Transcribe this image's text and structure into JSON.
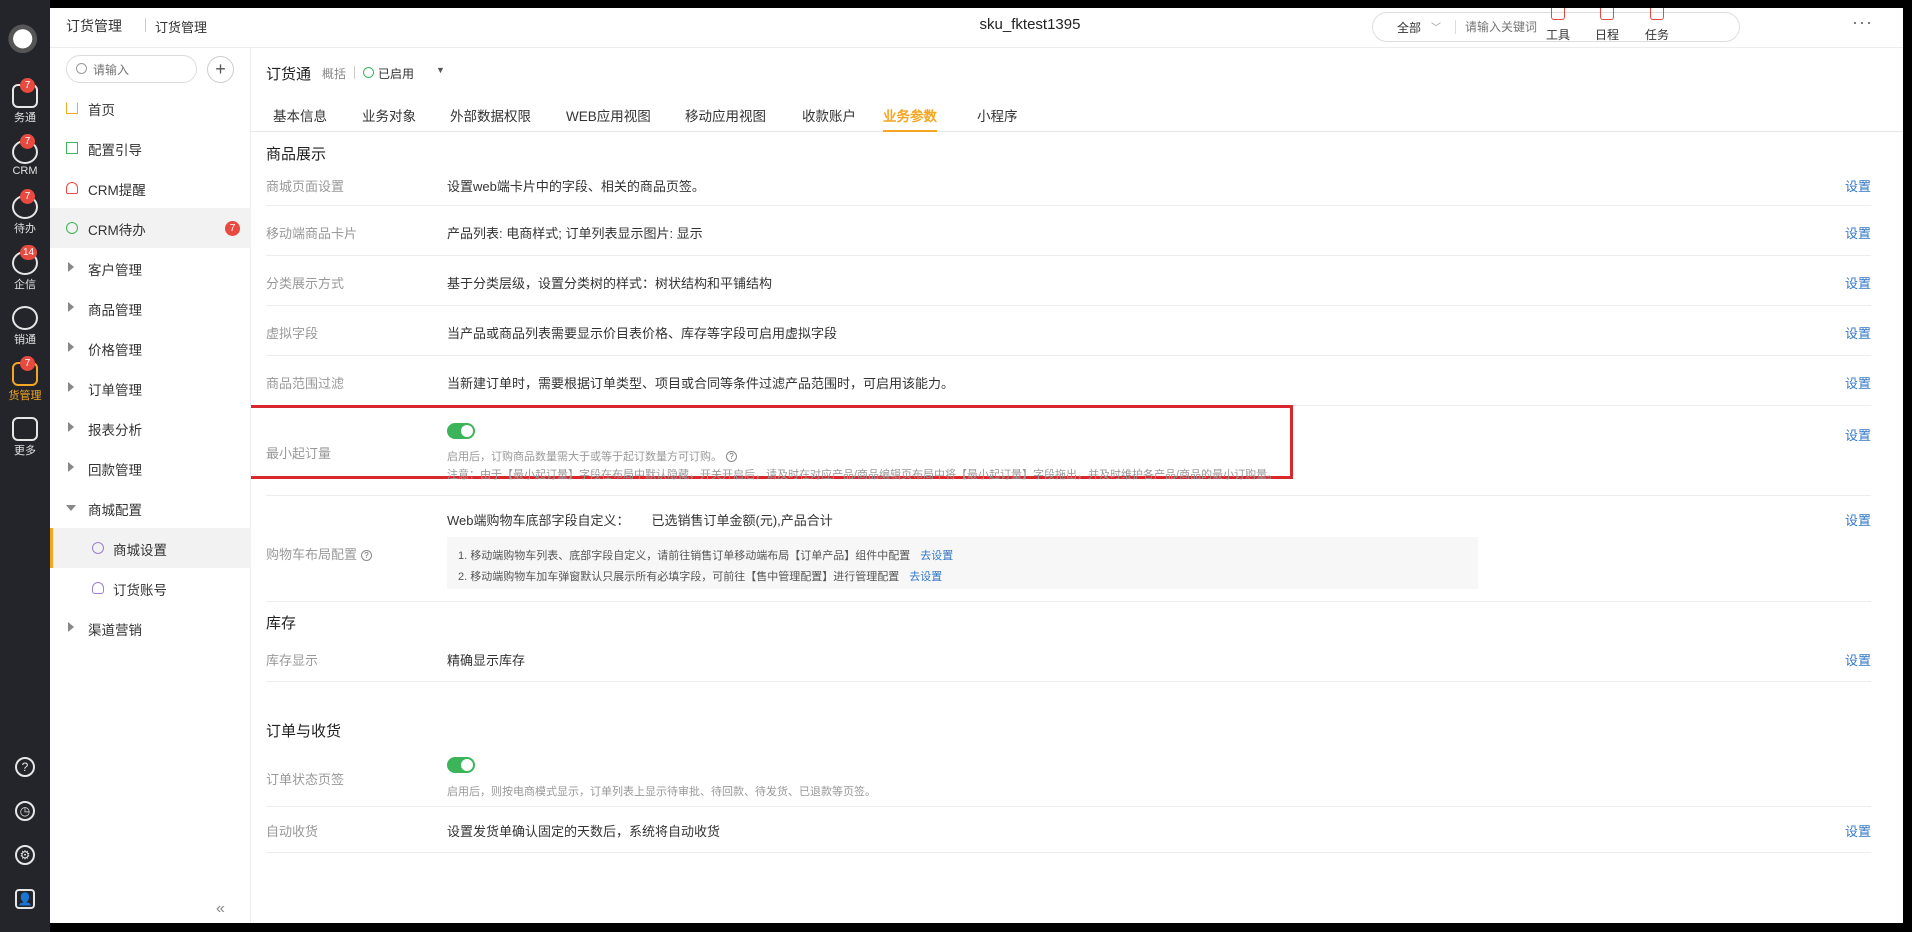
{
  "rail": {
    "items": [
      {
        "label": "业务通",
        "label_shown": "务通",
        "badge": "7"
      },
      {
        "label": "CRM",
        "badge": "7"
      },
      {
        "label": "待办",
        "badge": "7"
      },
      {
        "label": "企信",
        "badge": "14"
      },
      {
        "label": "营销通",
        "label_shown": "销通",
        "badge": ""
      },
      {
        "label": "订货管理",
        "label_shown": "货管理",
        "badge": "7"
      },
      {
        "label": "更多",
        "badge": ""
      }
    ]
  },
  "topbar": {
    "crumb1": "订货管理",
    "crumb2": "订货管理",
    "title": "sku_fktest1395",
    "search_scope": "全部",
    "search_placeholder": "请输入关键词",
    "tools": [
      "工具",
      "日程",
      "任务"
    ],
    "more": "···"
  },
  "sidebar": {
    "search_placeholder": "请输入",
    "add": "+",
    "items": [
      {
        "label": "首页"
      },
      {
        "label": "配置引导"
      },
      {
        "label": "CRM提醒"
      },
      {
        "label": "CRM待办",
        "badge": "7"
      },
      {
        "label": "客户管理"
      },
      {
        "label": "商品管理"
      },
      {
        "label": "价格管理"
      },
      {
        "label": "订单管理"
      },
      {
        "label": "报表分析"
      },
      {
        "label": "回款管理"
      },
      {
        "label": "商城配置"
      },
      {
        "label": "商城设置"
      },
      {
        "label": "订货账号"
      },
      {
        "label": "渠道营销"
      }
    ],
    "collapse": "«"
  },
  "main": {
    "app_title": "订货通",
    "app_sub": "概括",
    "status": "已启用",
    "tabs": [
      "基本信息",
      "业务对象",
      "外部数据权限",
      "WEB应用视图",
      "移动应用视图",
      "收款账户",
      "业务参数",
      "小程序"
    ],
    "active_tab": 6
  },
  "sections": {
    "goods": {
      "title": "商品展示",
      "rows": [
        {
          "label": "商城页面设置",
          "desc": "设置web端卡片中的字段、相关的商品页签。",
          "action": "设置"
        },
        {
          "label": "移动端商品卡片",
          "desc": "产品列表: 电商样式; 订单列表显示图片: 显示",
          "action": "设置"
        },
        {
          "label": "分类展示方式",
          "desc": "基于分类层级，设置分类树的样式：树状结构和平铺结构",
          "action": "设置"
        },
        {
          "label": "虚拟字段",
          "desc": "当产品或商品列表需要显示价目表价格、库存等字段可启用虚拟字段",
          "action": "设置"
        },
        {
          "label": "商品范围过滤",
          "desc": "当新建订单时，需要根据订单类型、项目或合同等条件过滤产品范围时，可启用该能力。",
          "action": "设置"
        }
      ],
      "min_order": {
        "label": "最小起订量",
        "hint1": "启用后，订购商品数量需大于或等于起订数量方可订购。",
        "hint2": "注意：由于【最小起订量】字段在布局中默认隐藏，开关开启后，请及时在对应产品/商品编辑页布局中将【最小起订量】字段拖出，并及时维护各产品/商品的最小订购量。",
        "action": "设置",
        "enabled": true
      },
      "cart": {
        "label": "购物车布局配置",
        "desc_label": "Web端购物车底部字段自定义：",
        "desc_value": "已选销售订单金额(元),产品合计",
        "note1": "1. 移动端购物车列表、底部字段自定义，请前往销售订单移动端布局【订单产品】组件中配置",
        "note2": "2. 移动端购物车加车弹窗默认只展示所有必填字段，可前往【售中管理配置】进行管理配置",
        "link": "去设置",
        "action": "设置"
      }
    },
    "stock": {
      "title": "库存",
      "rows": [
        {
          "label": "库存显示",
          "desc": "精确显示库存",
          "action": "设置"
        }
      ]
    },
    "order": {
      "title": "订单与收货",
      "status_tab": {
        "label": "订单状态页签",
        "hint": "启用后，则按电商模式显示，订单列表上显示待审批、待回款、待发货、已退款等页签。",
        "enabled": true
      },
      "auto_receive": {
        "label": "自动收货",
        "desc": "设置发货单确认固定的天数后，系统将自动收货",
        "action": "设置"
      }
    }
  },
  "colors": {
    "accent": "#f5a623",
    "link": "#3478c6",
    "toggle_on": "#3cb45a",
    "badge": "#e84a3f",
    "highlight_box": "#d9272e"
  }
}
